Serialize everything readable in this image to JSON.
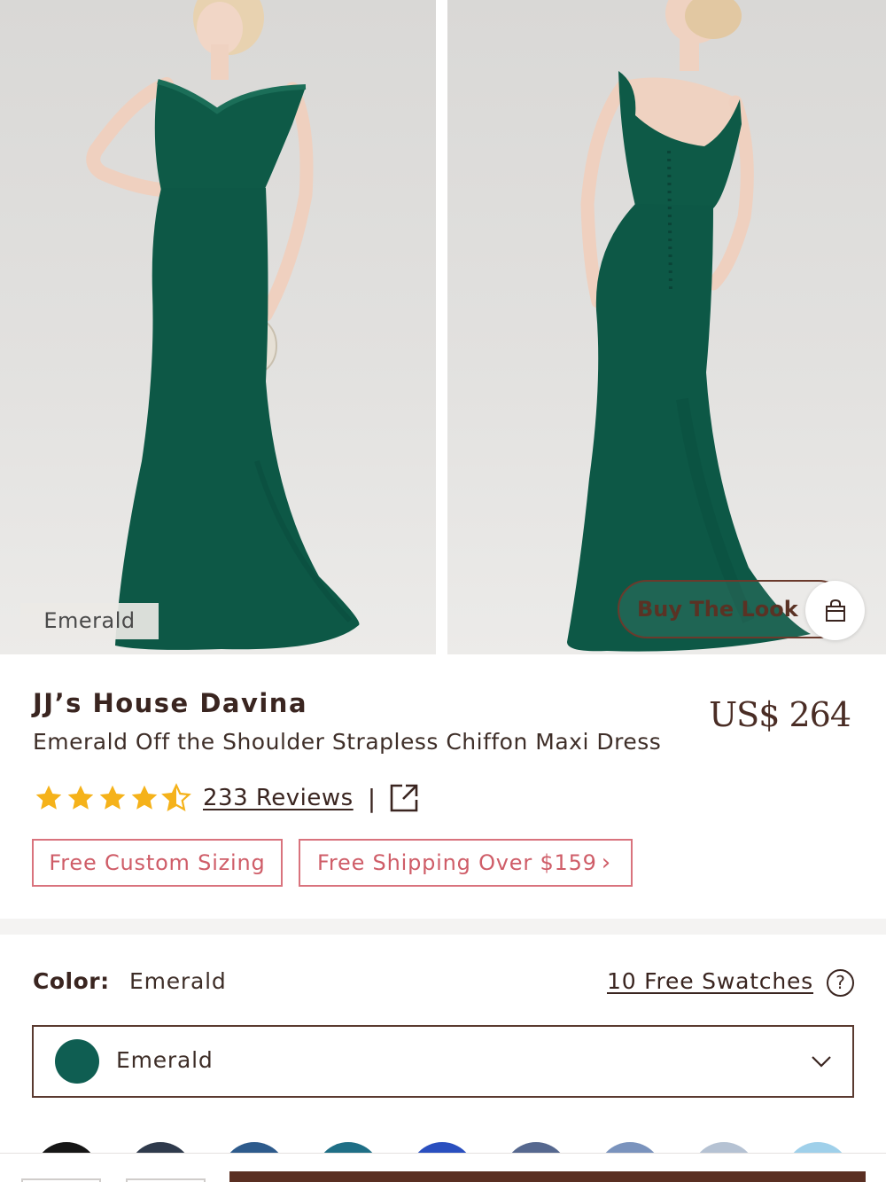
{
  "gallery": {
    "image1_color_tag": "Emerald",
    "buy_the_look_label": "Buy The Look",
    "bag_icon": "shopping-bag-icon"
  },
  "product": {
    "brand": "JJ’s House Davina",
    "subtitle": "Emerald Off the Shoulder Strapless Chiffon Maxi Dress",
    "price": "US$ 264",
    "rating": 4.5,
    "reviews_label": "233 Reviews",
    "separator": "|",
    "share_icon": "share-external-icon",
    "chips": {
      "custom_sizing": "Free Custom Sizing",
      "free_shipping": "Free Shipping Over $159",
      "chevron": "›"
    }
  },
  "color": {
    "label": "Color:",
    "value": "Emerald",
    "swatches_link": "10 Free Swatches",
    "help_icon": "?",
    "selected": "Emerald",
    "selected_hex": "#0f5e52",
    "swatch_hexes": [
      "#161616",
      "#2f3a4c",
      "#2e5b8c",
      "#1f6f86",
      "#2a4fbf",
      "#56688f",
      "#7a93bd",
      "#b5c2d3",
      "#9fd0ea"
    ]
  },
  "colors": {
    "dress_green": "#0e5a47",
    "accent_brown": "#5a2f22",
    "chip_pink": "#d9737d",
    "star_gold": "#f5b21a"
  }
}
